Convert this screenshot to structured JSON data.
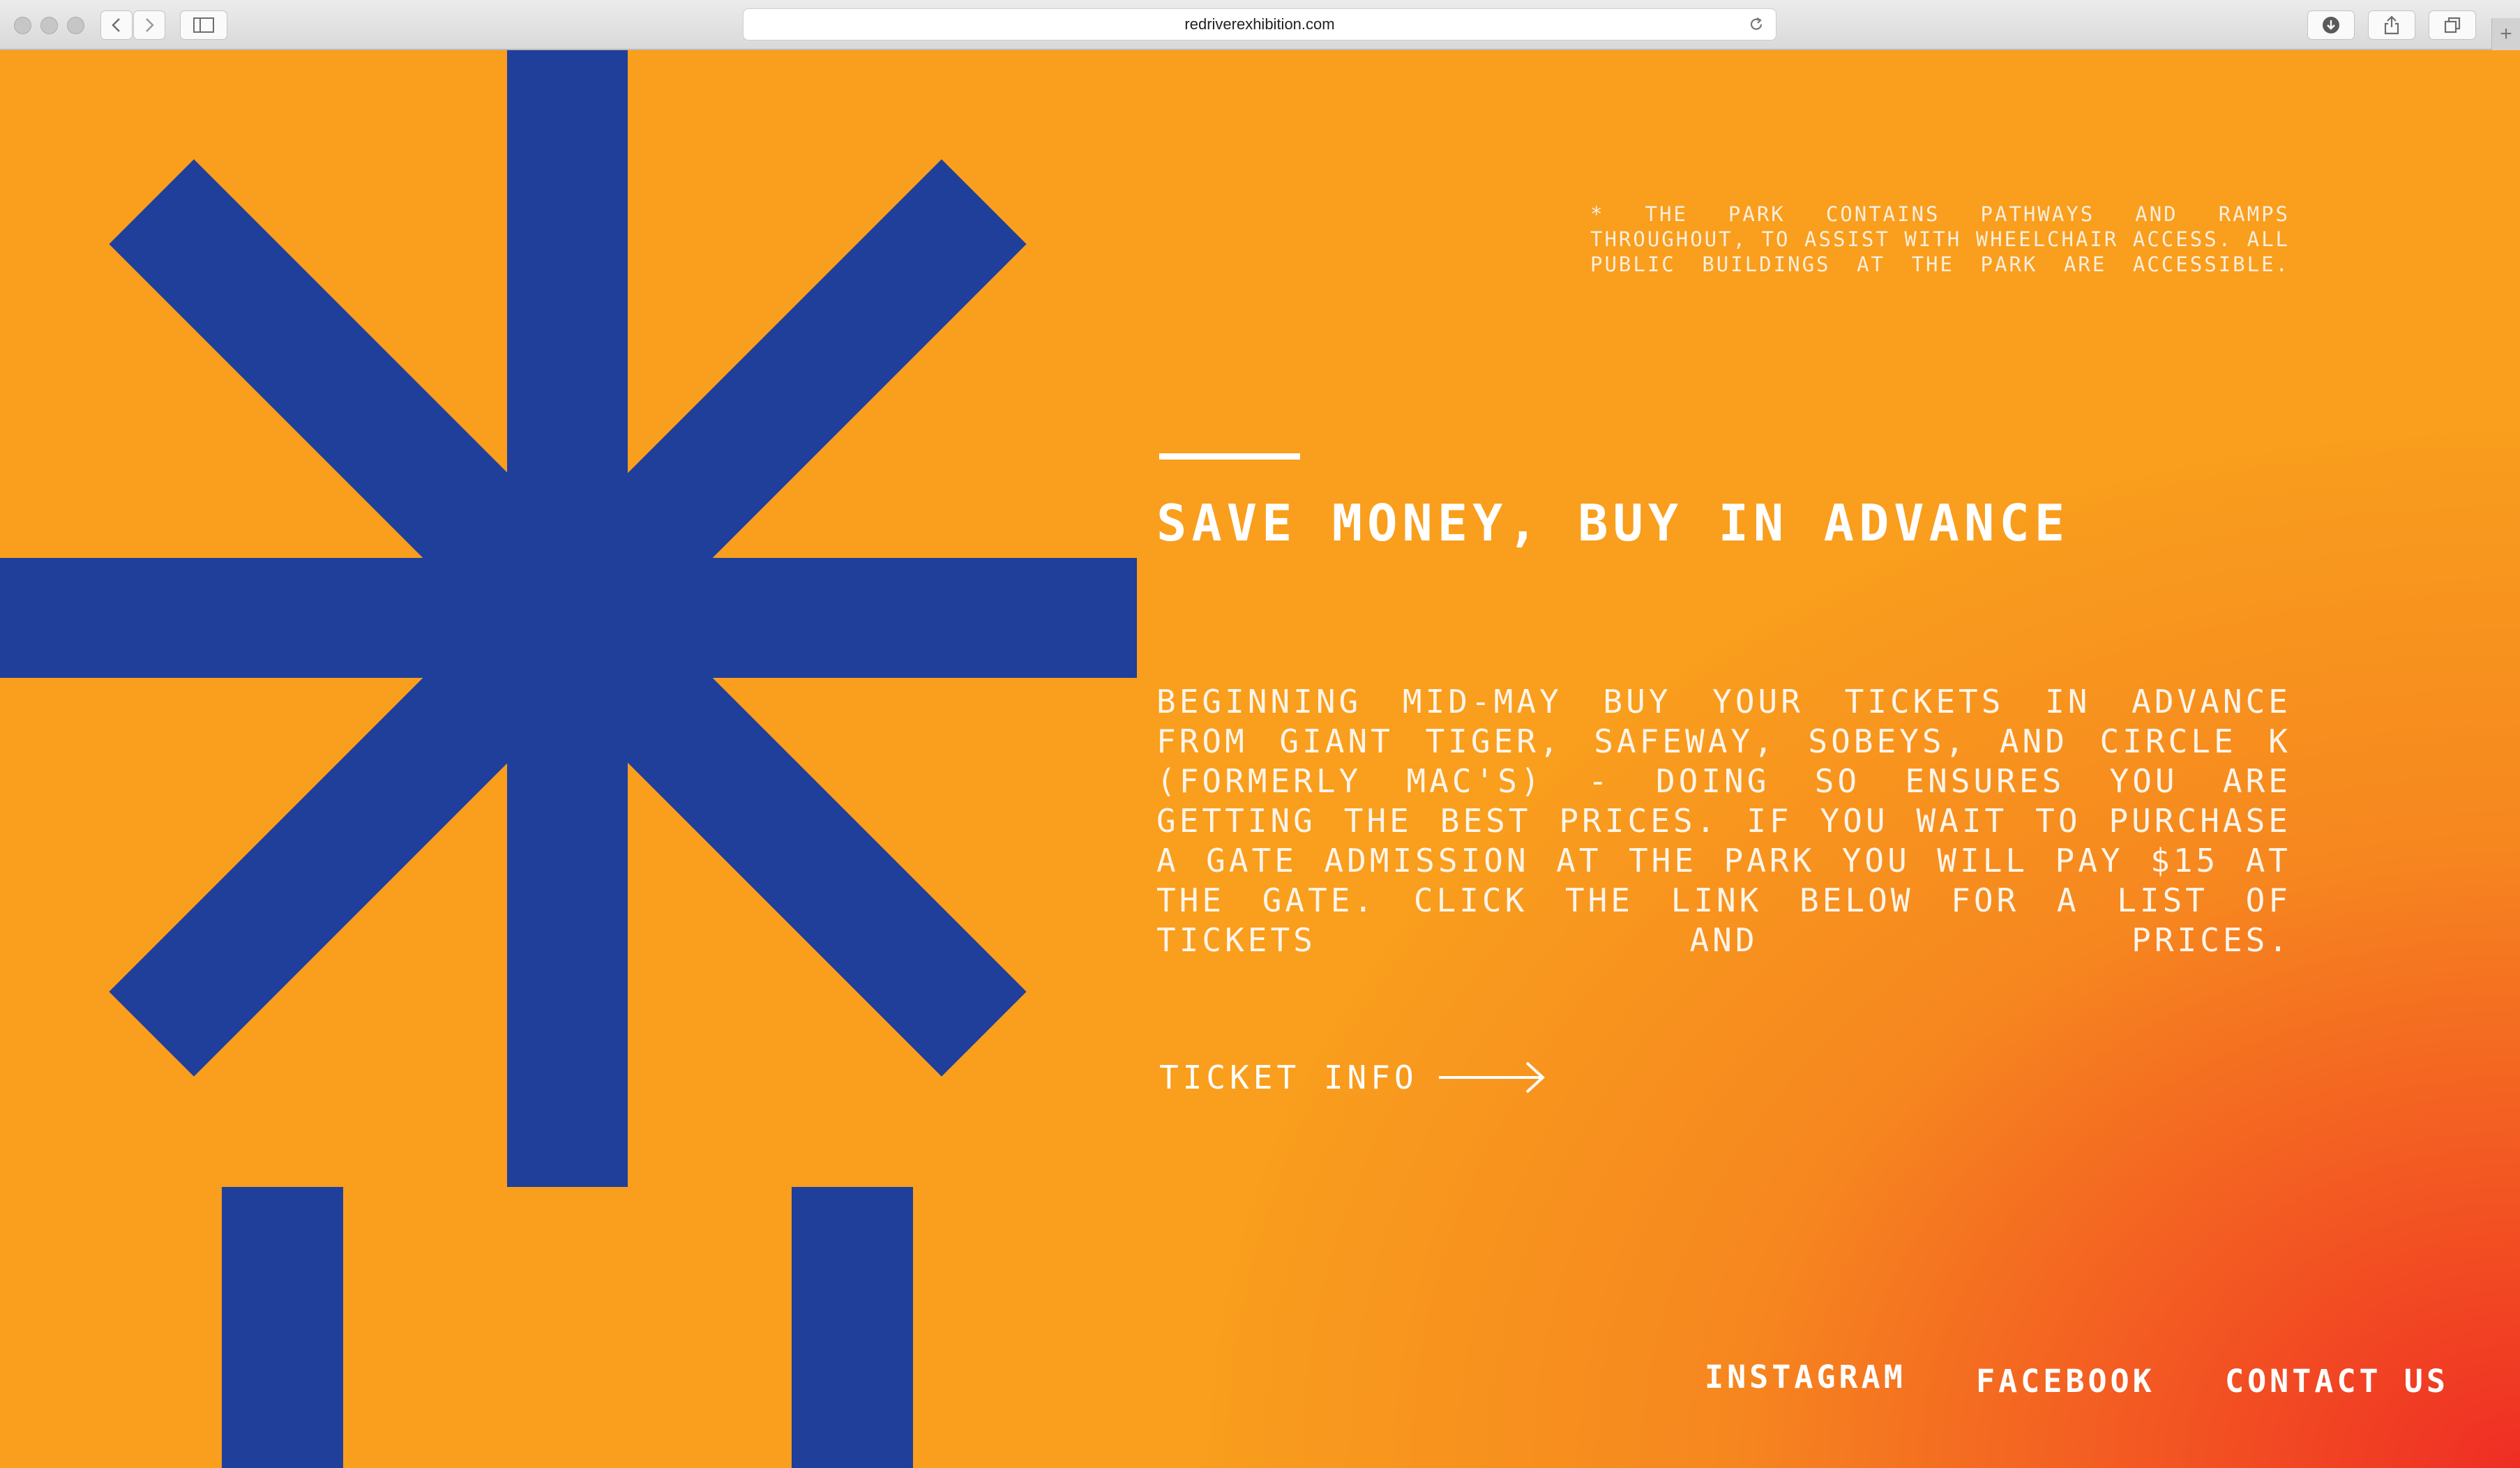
{
  "browser": {
    "url": "redriverexhibition.com"
  },
  "colors": {
    "background": "#f99e1d",
    "gradient_accent": "#ef2d24",
    "star": "#1f3f9b",
    "text": "#ffffff"
  },
  "note": {
    "text": "* THE PARK CONTAINS PATHWAYS AND RAMPS THROUGHOUT, TO ASSIST WITH WHEELCHAIR ACCESS. ALL PUBLIC BUILDINGS AT THE PARK ARE ACCESSIBLE."
  },
  "main": {
    "heading": "SAVE MONEY, BUY IN ADVANCE",
    "body": "BEGINNING MID-MAY BUY YOUR TICKETS IN ADVANCE FROM GIANT TIGER, SAFEWAY, SOBEYS, AND CIRCLE K (FORMERLY MAC'S) - DOING SO ENSURES YOU ARE GETTING THE BEST PRICES. IF YOU WAIT TO PURCHASE A GATE ADMISSION AT THE PARK YOU WILL PAY $15 AT THE GATE. CLICK THE LINK BELOW FOR A LIST OF TICKETS AND PRICES.",
    "ticket_link": "TICKET INFO"
  },
  "footer": {
    "instagram": "INSTAGRAM",
    "facebook": "FACEBOOK",
    "contact": "CONTACT US"
  }
}
